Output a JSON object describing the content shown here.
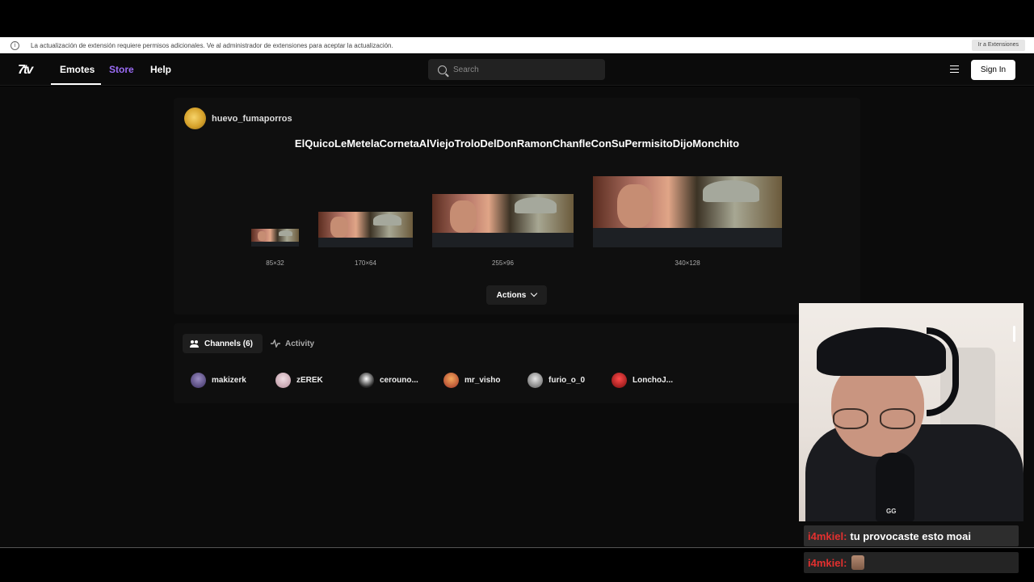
{
  "infobar": {
    "info_icon": "i",
    "message": "La actualización de extensión requiere permisos adicionales. Ve al administrador de extensiones para aceptar la actualización.",
    "button": "Ir a Extensiones"
  },
  "nav": {
    "logo": "7tv",
    "links": [
      "Emotes",
      "Store",
      "Help"
    ],
    "active": "Emotes",
    "search_placeholder": "Search",
    "signin": "Sign In",
    "store_color": "#9b6cf6"
  },
  "emote": {
    "owner": "huevo_fumaporros",
    "name": "ElQuicoLeMetelaCornetaAlViejoTroloDelDonRamonChanfleConSuPermisitoDijoMonchito",
    "sizes": [
      "85×32",
      "170×64",
      "255×96",
      "340×128"
    ],
    "actions_label": "Actions"
  },
  "channels": {
    "tabs": [
      "Channels (6)",
      "Activity"
    ],
    "list": [
      "makizerk",
      "zEREK",
      "cerouno...",
      "mr_visho",
      "furio_o_0",
      "LonchoJ..."
    ]
  },
  "webcam": {
    "mic_label": "GG"
  },
  "chat": [
    {
      "user": "i4mkiel:",
      "message": "tu provocaste esto moai"
    },
    {
      "user": "i4mkiel:",
      "message": ""
    }
  ],
  "colors": {
    "chat_user": "#e3302f",
    "background": "#0b0b0b"
  }
}
